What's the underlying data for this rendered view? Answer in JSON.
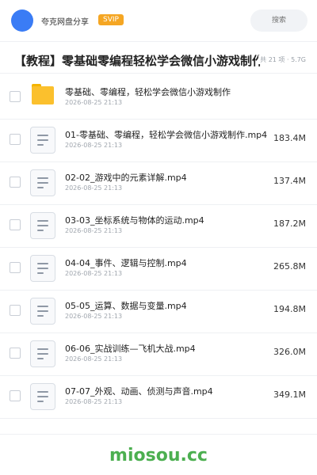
{
  "header": {
    "app_name": "夸克网盘分享",
    "badge": "SVIP",
    "search_placeholder": "搜索",
    "logo_color": "#3a7cf5"
  },
  "share": {
    "title": "【教程】零基础零编程轻松学会微信小游戏制作",
    "meta": "共 21 项 · 5.7G"
  },
  "files": [
    {
      "icon": "folder-icon",
      "name": "零基础、零编程，轻松学会微信小游戏制作",
      "date": "2026-08-25 21:13",
      "size": ""
    },
    {
      "icon": "video-file-icon",
      "name": "01-零基础、零编程，轻松学会微信小游戏制作.mp4",
      "date": "2026-08-25 21:13",
      "size": "183.4M"
    },
    {
      "icon": "video-file-icon",
      "name": "02-02_游戏中的元素详解.mp4",
      "date": "2026-08-25 21:13",
      "size": "137.4M"
    },
    {
      "icon": "video-file-icon",
      "name": "03-03_坐标系统与物体的运动.mp4",
      "date": "2026-08-25 21:13",
      "size": "187.2M"
    },
    {
      "icon": "video-file-icon",
      "name": "04-04_事件、逻辑与控制.mp4",
      "date": "2026-08-25 21:13",
      "size": "265.8M"
    },
    {
      "icon": "video-file-icon",
      "name": "05-05_运算、数据与变量.mp4",
      "date": "2026-08-25 21:13",
      "size": "194.8M"
    },
    {
      "icon": "video-file-icon",
      "name": "06-06_实战训练—飞机大战.mp4",
      "date": "2026-08-25 21:13",
      "size": "326.0M"
    },
    {
      "icon": "video-file-icon",
      "name": "07-07_外观、动画、侦测与声音.mp4",
      "date": "2026-08-25 21:13",
      "size": "349.1M"
    }
  ],
  "watermark": "miosou.cc"
}
